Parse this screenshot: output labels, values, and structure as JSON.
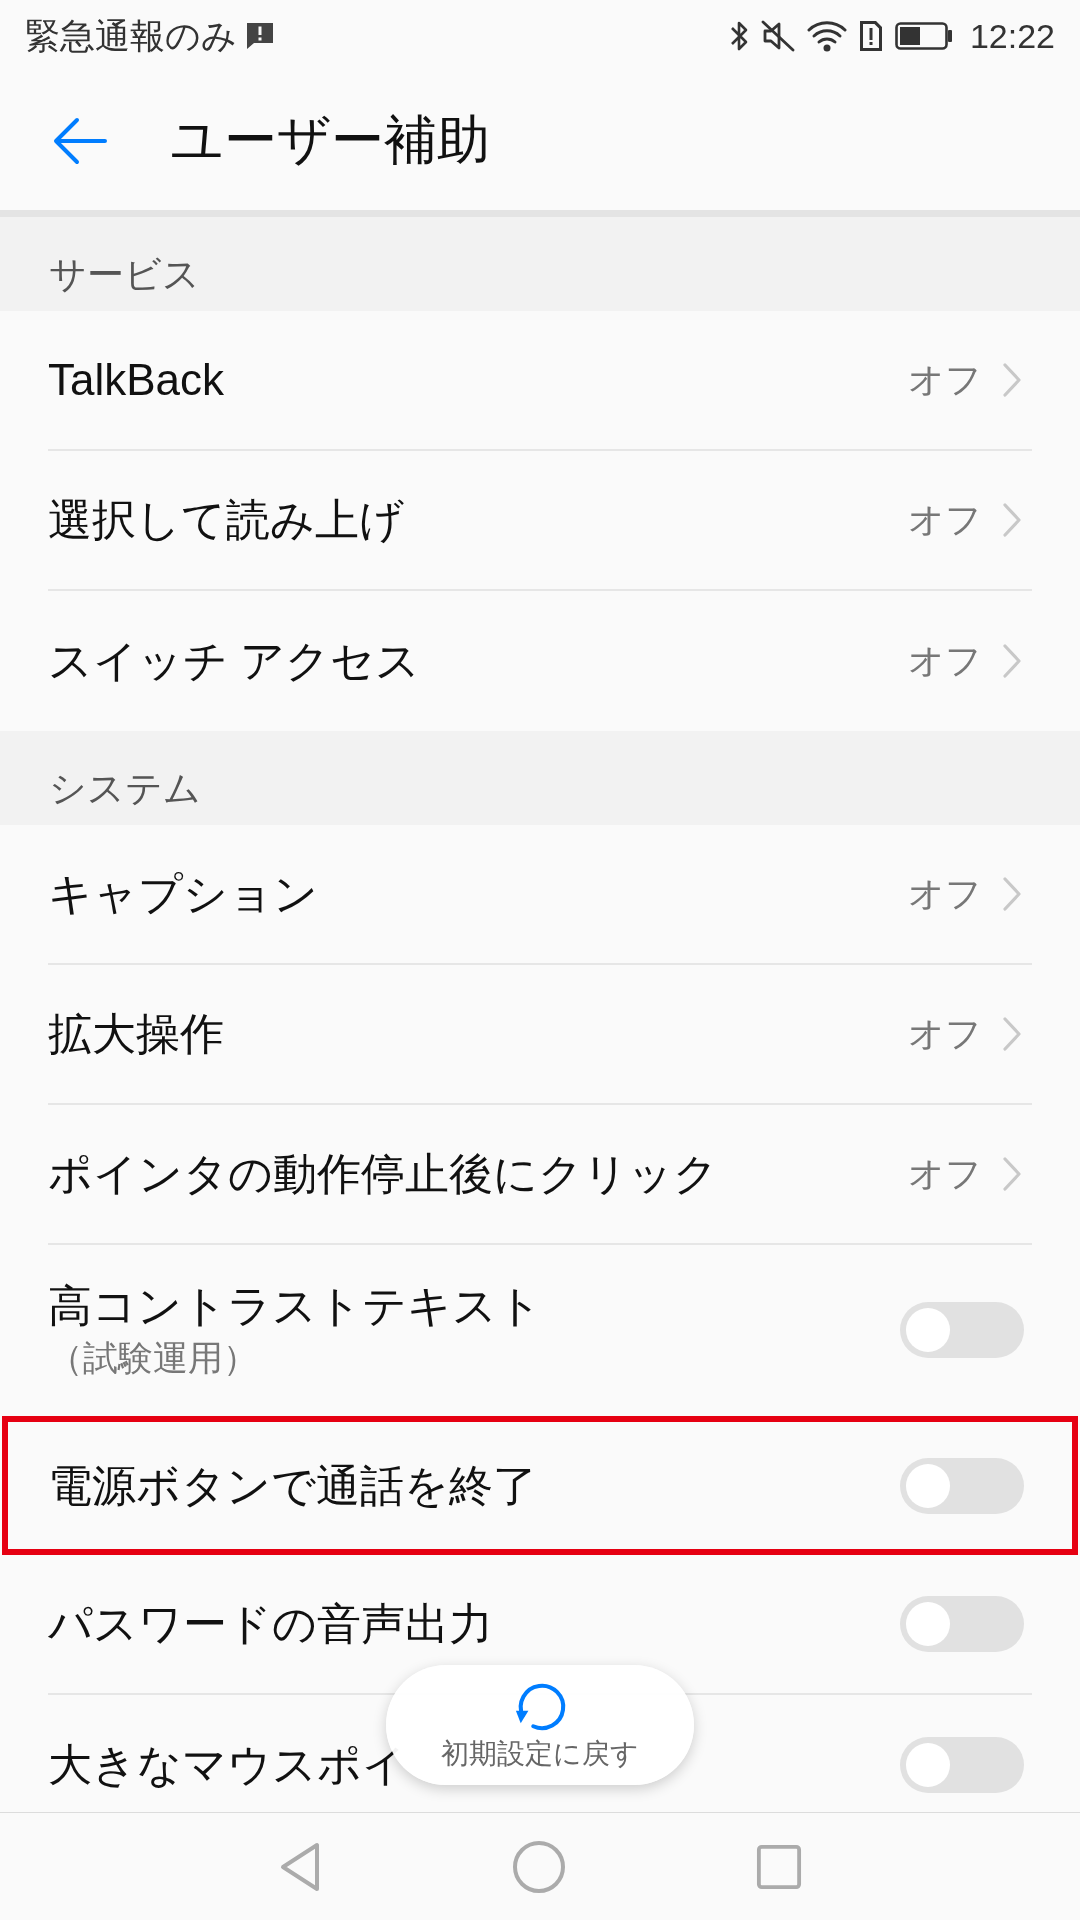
{
  "status_bar": {
    "notice": "緊急通報のみ",
    "time": "12:22"
  },
  "header": {
    "title": "ユーザー補助"
  },
  "sections": [
    {
      "title": "サービス",
      "items": [
        {
          "kind": "link",
          "label": "TalkBack",
          "value": "オフ",
          "highlighted": false
        },
        {
          "kind": "link",
          "label": "選択して読み上げ",
          "value": "オフ",
          "highlighted": false
        },
        {
          "kind": "link",
          "label": "スイッチ アクセス",
          "value": "オフ",
          "highlighted": false
        }
      ]
    },
    {
      "title": "システム",
      "items": [
        {
          "kind": "link",
          "label": "キャプション",
          "value": "オフ",
          "highlighted": false
        },
        {
          "kind": "link",
          "label": "拡大操作",
          "value": "オフ",
          "highlighted": false
        },
        {
          "kind": "link",
          "label": "ポインタの動作停止後にクリック",
          "value": "オフ",
          "highlighted": false
        },
        {
          "kind": "toggle",
          "label": "高コントラストテキスト",
          "sublabel": "（試験運用）",
          "on": false,
          "highlighted": false
        },
        {
          "kind": "toggle",
          "label": "電源ボタンで通話を終了",
          "on": false,
          "highlighted": true
        },
        {
          "kind": "toggle",
          "label": "パスワードの音声出力",
          "on": false,
          "highlighted": false
        },
        {
          "kind": "toggle",
          "label": "大きなマウスポイ",
          "on": false,
          "highlighted": false
        }
      ]
    }
  ],
  "floating_button": {
    "label": "初期設定に戻す"
  }
}
